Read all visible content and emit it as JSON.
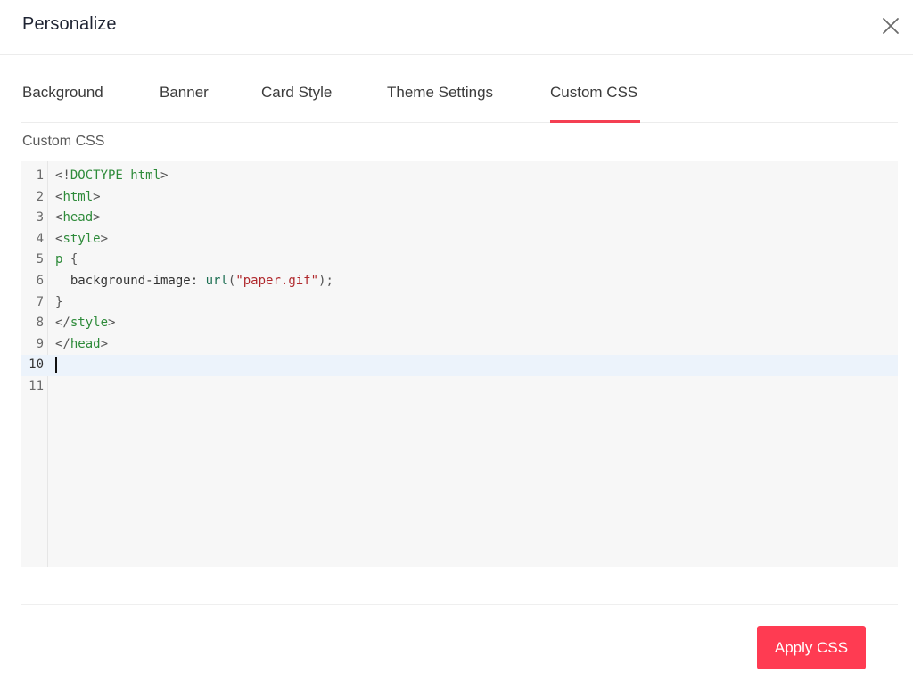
{
  "dialog": {
    "title": "Personalize",
    "close_icon": "close-icon"
  },
  "tabs": [
    {
      "label": "Background",
      "active": false
    },
    {
      "label": "Banner",
      "active": false
    },
    {
      "label": "Card Style",
      "active": false
    },
    {
      "label": "Theme Settings",
      "active": false
    },
    {
      "label": "Custom CSS",
      "active": true
    }
  ],
  "accent_color": "#f43f52",
  "section": {
    "label": "Custom CSS"
  },
  "editor": {
    "active_line": 10,
    "lines": [
      {
        "number": "1",
        "tokens": [
          {
            "t": "<!",
            "c": "punct"
          },
          {
            "t": "DOCTYPE html",
            "c": "tag"
          },
          {
            "t": ">",
            "c": "punct"
          }
        ]
      },
      {
        "number": "2",
        "tokens": [
          {
            "t": "<",
            "c": "punct"
          },
          {
            "t": "html",
            "c": "tag"
          },
          {
            "t": ">",
            "c": "punct"
          }
        ]
      },
      {
        "number": "3",
        "tokens": [
          {
            "t": "<",
            "c": "punct"
          },
          {
            "t": "head",
            "c": "tag"
          },
          {
            "t": ">",
            "c": "punct"
          }
        ]
      },
      {
        "number": "4",
        "tokens": [
          {
            "t": "<",
            "c": "punct"
          },
          {
            "t": "style",
            "c": "tag"
          },
          {
            "t": ">",
            "c": "punct"
          }
        ]
      },
      {
        "number": "5",
        "tokens": [
          {
            "t": "p",
            "c": "tag"
          },
          {
            "t": " {",
            "c": "punct"
          }
        ]
      },
      {
        "number": "6",
        "tokens": [
          {
            "t": "  background-image: ",
            "c": "prop"
          },
          {
            "t": "url",
            "c": "fn"
          },
          {
            "t": "(",
            "c": "punct"
          },
          {
            "t": "\"paper.gif\"",
            "c": "str"
          },
          {
            "t": ");",
            "c": "punct"
          }
        ]
      },
      {
        "number": "7",
        "tokens": [
          {
            "t": "}",
            "c": "punct"
          }
        ]
      },
      {
        "number": "8",
        "tokens": [
          {
            "t": "</",
            "c": "punct"
          },
          {
            "t": "style",
            "c": "tag"
          },
          {
            "t": ">",
            "c": "punct"
          }
        ]
      },
      {
        "number": "9",
        "tokens": [
          {
            "t": "</",
            "c": "punct"
          },
          {
            "t": "head",
            "c": "tag"
          },
          {
            "t": ">",
            "c": "punct"
          }
        ]
      },
      {
        "number": "10",
        "tokens": []
      },
      {
        "number": "11",
        "tokens": []
      }
    ]
  },
  "footer": {
    "apply_label": "Apply CSS",
    "apply_color": "#ff3b52"
  }
}
